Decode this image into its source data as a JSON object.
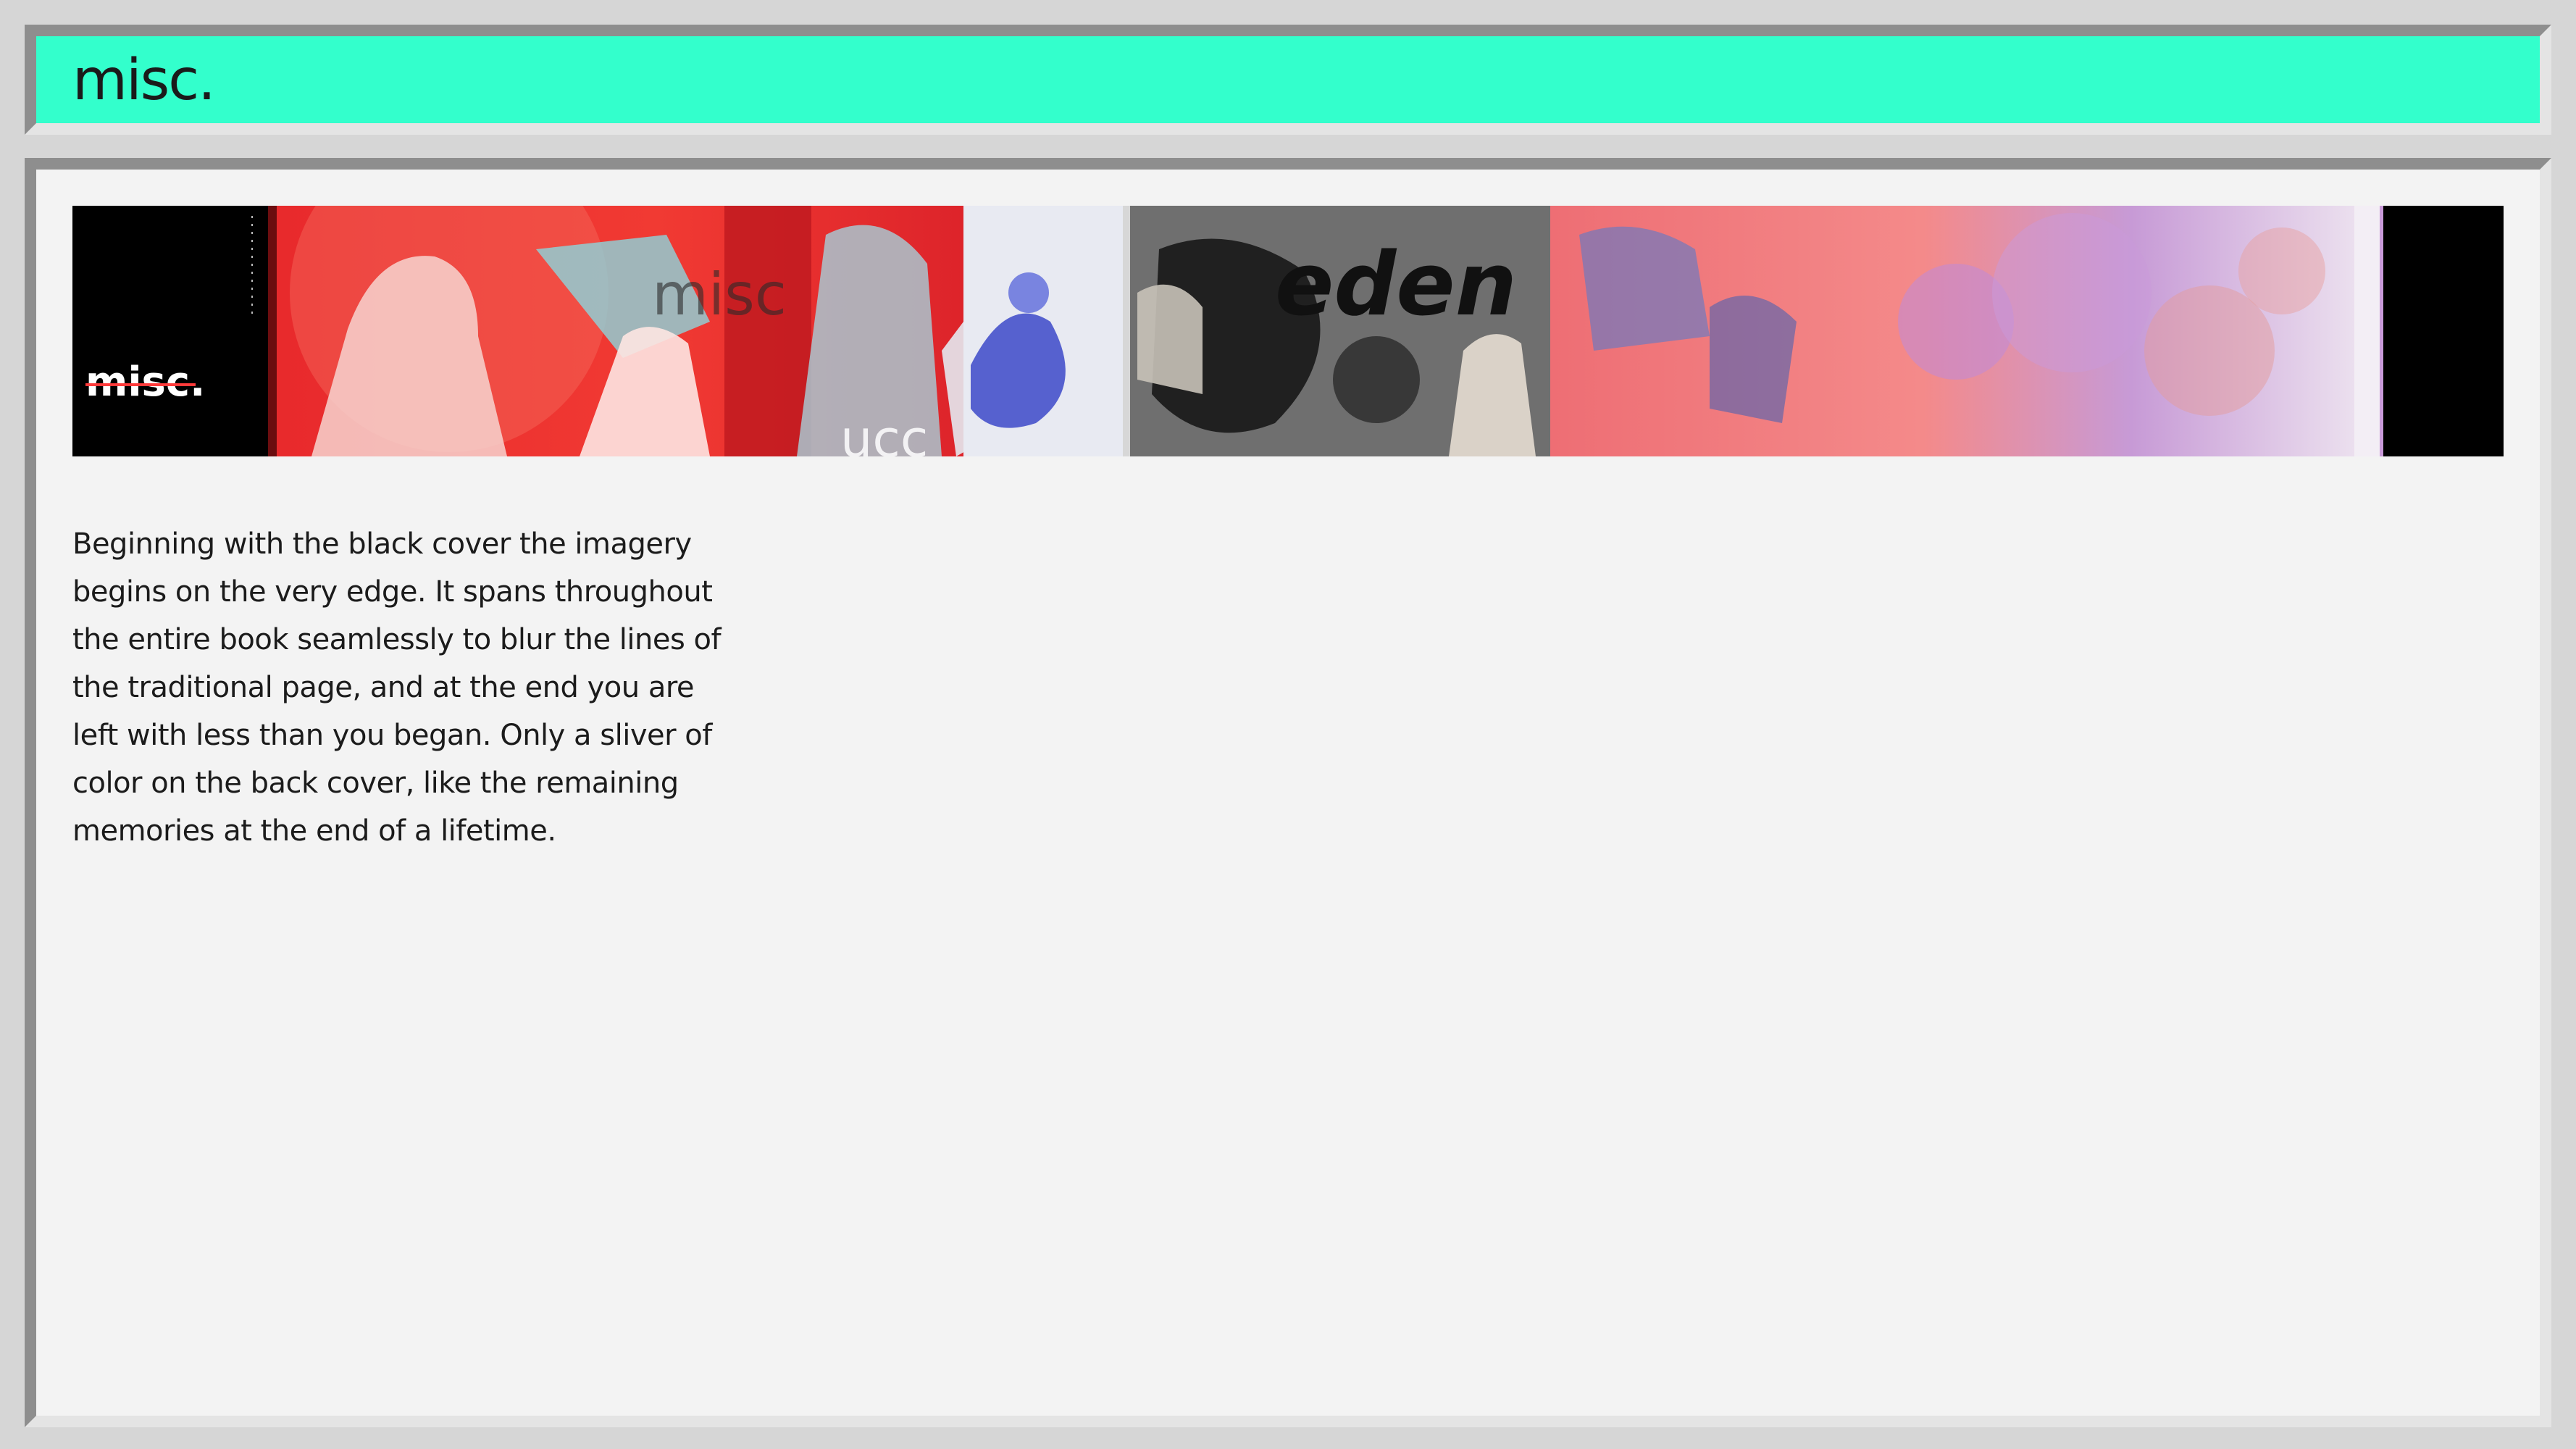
{
  "header": {
    "title": "misc."
  },
  "banner": {
    "logo_text": "misc.",
    "word_eden": "eden",
    "word_misc": "misc",
    "word_ucc": "ucc"
  },
  "main": {
    "description": "Beginning with the black cover the imagery begins on the very edge. It spans throughout the entire book seamlessly to blur the lines of the traditional page, and at the end you are left with less than you began. Only a sliver of color on the back cover, like the remaining memories at the end of a lifetime."
  },
  "colors": {
    "accent": "#33ffcc",
    "window_bg": "#f3f3f3",
    "bevel_dark": "#8e8e8e",
    "bevel_light": "#e4e4e4"
  }
}
